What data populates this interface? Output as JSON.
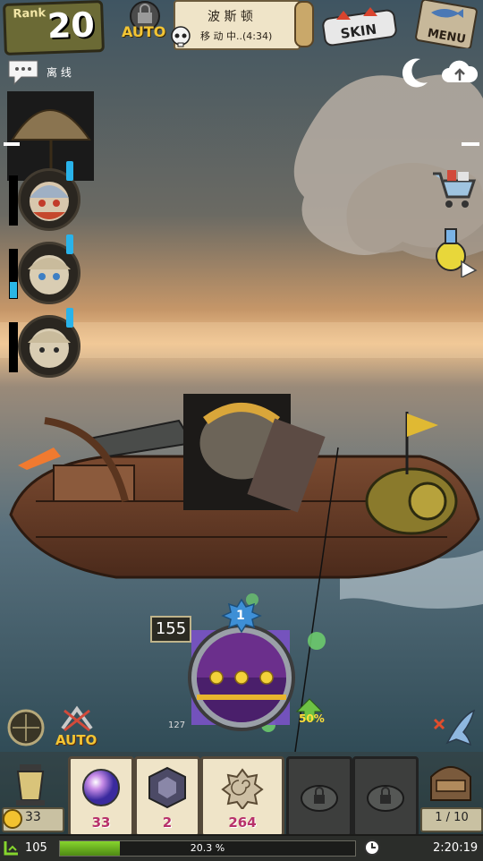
{
  "topbar": {
    "rank_label": "Rank",
    "rank_value": "20",
    "auto_label": "AUTO",
    "location_name": "波 斯 顿",
    "location_status": "移 动 中..(4:34)",
    "skin_label": "SKIN",
    "menu_label": "MENU"
  },
  "chat": {
    "label": "离 线"
  },
  "hud": {
    "tension_value": "155",
    "tension_level": "1",
    "small_value": "127",
    "boost_percent": "50%",
    "auto_label": "AUTO"
  },
  "slots": [
    {
      "count": "33",
      "item": "rainbow-orb-icon",
      "locked": false
    },
    {
      "count": "2",
      "item": "dark-gem-icon",
      "locked": false
    },
    {
      "count": "264",
      "item": "shell-icon",
      "locked": false
    },
    {
      "count": "",
      "item": "lock-icon",
      "locked": true
    },
    {
      "count": "",
      "item": "lock-icon",
      "locked": true
    }
  ],
  "coins": "33",
  "bag": "1 / 10",
  "status": {
    "level": "105",
    "xp_percent_label": "20.3 %",
    "xp_fraction": 0.203,
    "time": "2:20:19"
  },
  "colors": {
    "accent_blue": "#29b3ea",
    "xp_green": "#86d52d",
    "gold": "#f3c534"
  }
}
